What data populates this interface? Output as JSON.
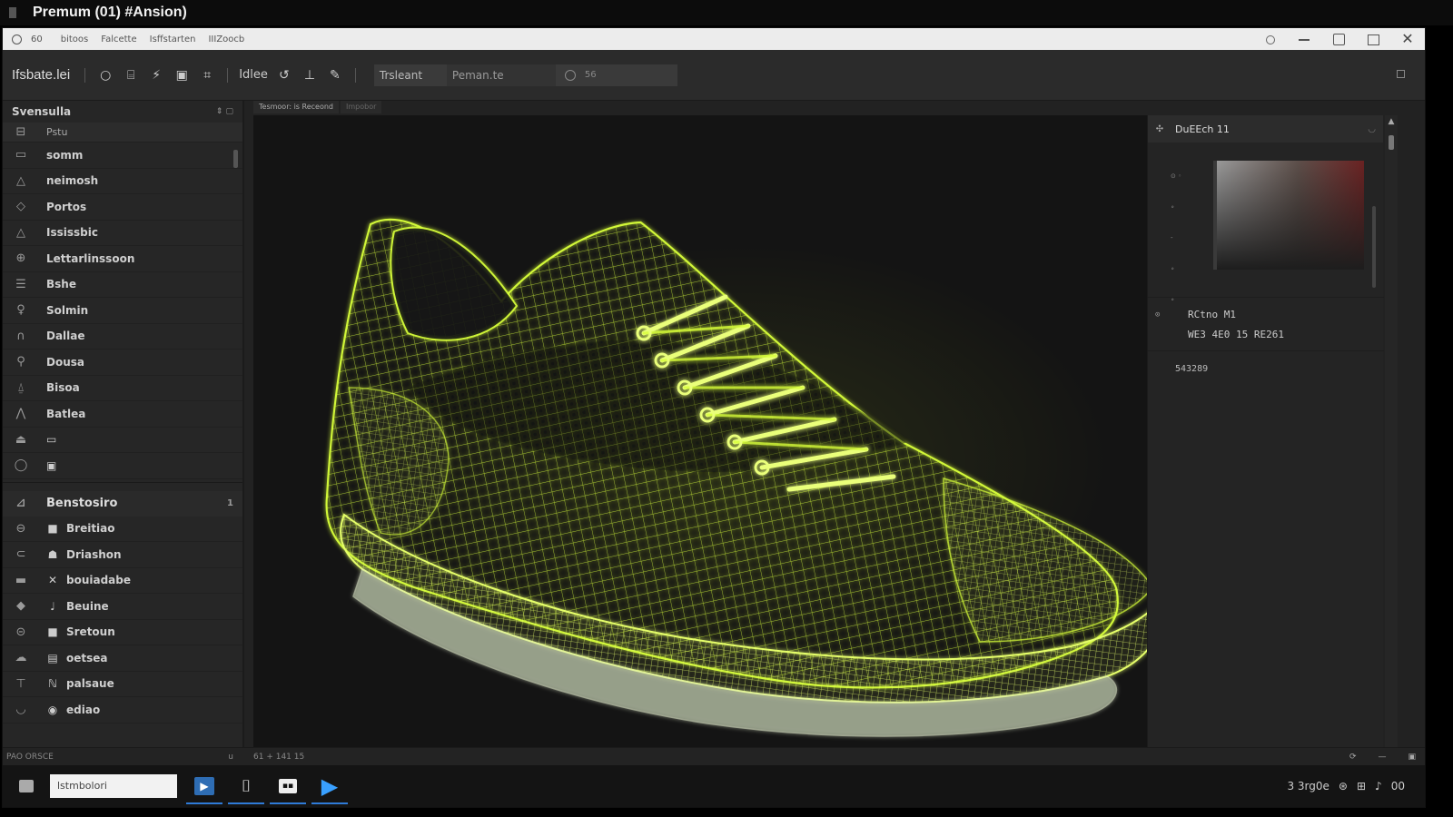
{
  "window_title": "Premum  (01) #Ansion)",
  "menubar": {
    "left_icon": "circle-icon",
    "badge": "60",
    "items": [
      "bitoos",
      "Falcette",
      "Isffstarten",
      "IIIZoocb"
    ]
  },
  "toolbar": {
    "title": "Ifsbate.lei",
    "label1": "Idlee",
    "search_label": "Trsleant",
    "search_value": "Peman.te",
    "search_count": "56"
  },
  "tabs": [
    "Tesmoor: is Receond",
    "Impobor"
  ],
  "left_panel": {
    "section1_title": "Svensulla",
    "subheader": "Pstu",
    "items": [
      {
        "icon": "panel-icon",
        "label": "somm"
      },
      {
        "icon": "triangle-icon",
        "label": "neimosh"
      },
      {
        "icon": "tag-icon",
        "label": "Portos"
      },
      {
        "icon": "triangle-icon",
        "label": "Ississbic"
      },
      {
        "icon": "globe-icon",
        "label": "Lettarlinssoon"
      },
      {
        "icon": "layers-icon",
        "label": "Bshe"
      },
      {
        "icon": "pin-icon",
        "label": "Solmin"
      },
      {
        "icon": "arch-icon",
        "label": "Dallae"
      },
      {
        "icon": "person-icon",
        "label": "Dousa"
      },
      {
        "icon": "bell-icon",
        "label": "Bisoa"
      },
      {
        "icon": "caret-icon",
        "label": "Batlea"
      },
      {
        "icon": "tool-icon",
        "label": "▭"
      },
      {
        "icon": "location-icon",
        "label": "▣"
      }
    ],
    "section2_title": "Benstosiro",
    "section2_count": "1",
    "items2": [
      {
        "icon": "ring-icon",
        "glyph": "■",
        "label": "Breitiao"
      },
      {
        "icon": "chat-icon",
        "glyph": "☗",
        "label": "Driashon"
      },
      {
        "icon": "bar-icon",
        "glyph": "✕",
        "label": "bouiadabe"
      },
      {
        "icon": "diamond-icon",
        "glyph": "♩",
        "label": "Beuine"
      },
      {
        "icon": "link-icon",
        "glyph": "■",
        "label": "Sretoun"
      },
      {
        "icon": "cloud-icon",
        "glyph": "▤",
        "label": "oetsea"
      },
      {
        "icon": "stand-icon",
        "glyph": "ℕ",
        "label": "palsaue"
      },
      {
        "icon": "curve-icon",
        "glyph": "◉",
        "label": "ediao"
      }
    ]
  },
  "right_panel": {
    "title": "DuEEch 11",
    "info_line1": "RCtno M1",
    "info_line2": "WE3 4E0 15 RE261",
    "code": "543289"
  },
  "statusbar": {
    "left": "PAO ORSCE",
    "left_marker": "u",
    "coords": "61 +  141  15"
  },
  "taskbar": {
    "input_value": "lstmbolori",
    "tray_text": "3 3rg0e",
    "tray_right": "00"
  },
  "colors": {
    "wireframe": "#d8ff3a",
    "accent": "#2f7bd8",
    "panel_bg": "#262626",
    "viewport_bg": "#141414"
  }
}
